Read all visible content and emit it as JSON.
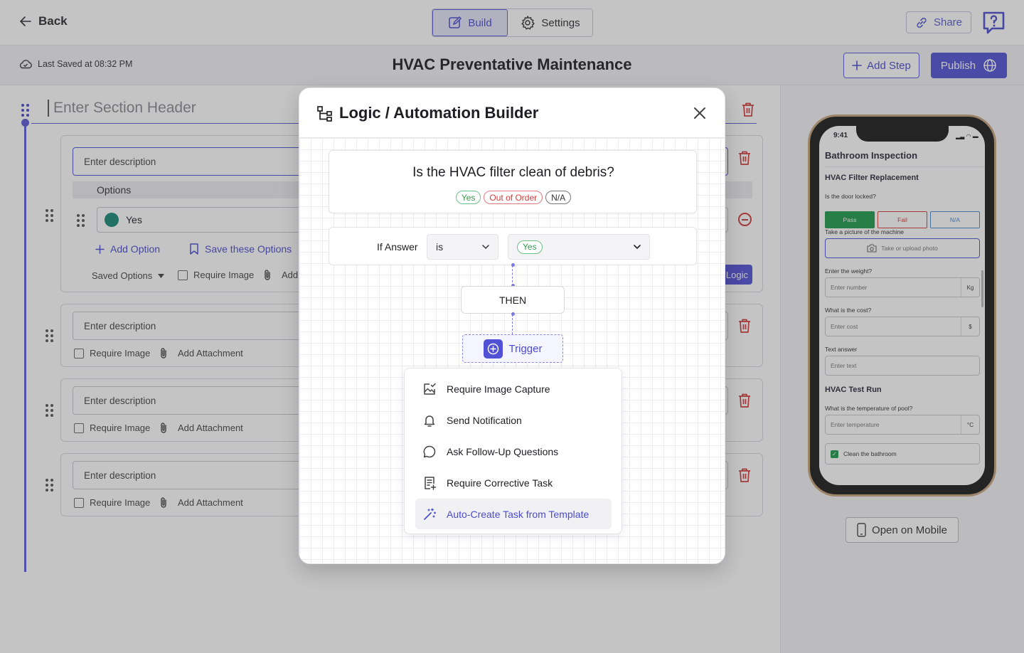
{
  "topbar": {
    "back_label": "Back",
    "build_tab": "Build",
    "settings_tab": "Settings",
    "share_label": "Share"
  },
  "subbar": {
    "last_saved": "Last Saved at 08:32 PM",
    "title": "HVAC Preventative Maintenance",
    "add_step": "Add Step",
    "publish": "Publish"
  },
  "editor": {
    "section_header_placeholder": "Enter Section Header",
    "cards": [
      {
        "description": "Enter description",
        "options_label": "Options",
        "option_value": "Yes",
        "add_option": "Add Option",
        "save_options": "Save these Options",
        "saved_options": "Saved Options",
        "require_image": "Require Image",
        "add_short": "Add",
        "logic_label": "Logic"
      },
      {
        "description": "Enter description",
        "require_image": "Require Image",
        "add_attachment": "Add Attachment"
      },
      {
        "description": "Enter description",
        "require_image": "Require Image",
        "add_attachment": "Add Attachment"
      },
      {
        "description": "Enter description",
        "require_image": "Require Image",
        "add_attachment": "Add Attachment"
      }
    ]
  },
  "modal": {
    "title": "Logic / Automation Builder",
    "question": "Is the HVAC filter clean of debris?",
    "answer_chips": [
      "Yes",
      "Out of Order",
      "N/A"
    ],
    "if_answer_label": "If Answer",
    "operator_value": "is",
    "answer_value": "Yes",
    "then_label": "THEN",
    "trigger_label": "Trigger",
    "trigger_menu": [
      {
        "label": "Require Image Capture",
        "icon": "image-check-icon"
      },
      {
        "label": "Send Notification",
        "icon": "bell-icon"
      },
      {
        "label": "Ask Follow-Up Questions",
        "icon": "chat-bubble-icon"
      },
      {
        "label": "Require Corrective Task",
        "icon": "task-add-icon"
      },
      {
        "label": "Auto-Create Task from Template",
        "icon": "magic-wand-icon",
        "highlighted": true
      }
    ]
  },
  "phone_preview": {
    "time": "9:41",
    "title": "Bathroom Inspection",
    "section1": "HVAC Filter Replacement",
    "q_door": "Is the door locked?",
    "pass": "Pass",
    "fail": "Fail",
    "na": "N/A",
    "q_picture": "Take a picture of the machine",
    "photo_btn": "Take or upload photo",
    "q_weight": "Enter the weight?",
    "weight_placeholder": "Enter number",
    "weight_unit": "Kg",
    "q_cost": "What is the cost?",
    "cost_placeholder": "Enter cost",
    "cost_unit": "$",
    "q_text": "Text answer",
    "text_placeholder": "Enter text",
    "section2": "HVAC Test Run",
    "q_temp": "What is the temperature of pool?",
    "temp_placeholder": "Enter temperature",
    "temp_unit": "°C",
    "checkbox_label": "Clean the bathroom"
  },
  "open_on_mobile": "Open on Mobile",
  "colors": {
    "accent": "#5151d6",
    "danger": "#d23a3a",
    "success": "#2f9a4a",
    "teal": "#168a78"
  }
}
